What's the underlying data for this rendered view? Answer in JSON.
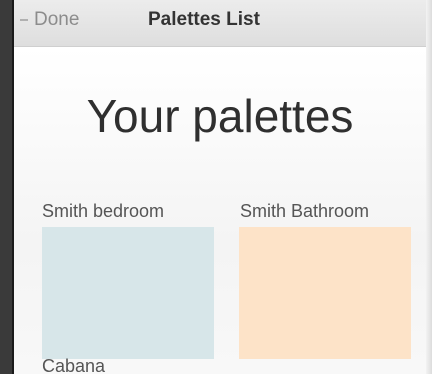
{
  "nav": {
    "back_label": "Done",
    "title": "Palettes List"
  },
  "main": {
    "heading": "Your palettes",
    "palettes": [
      {
        "name": "Smith bedroom",
        "color": "#d7e6e9"
      },
      {
        "name": "Smith Bathroom",
        "color": "#fde3c8"
      },
      {
        "name": "Cabana"
      }
    ]
  }
}
